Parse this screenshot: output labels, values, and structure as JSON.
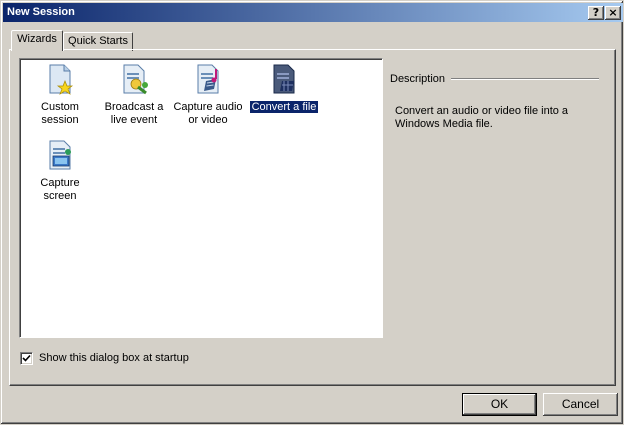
{
  "window": {
    "title": "New Session"
  },
  "titlebar": {
    "help_glyph": "?",
    "close_glyph": "×"
  },
  "tabs": [
    {
      "label": "Wizards",
      "active": true
    },
    {
      "label": "Quick Starts",
      "active": false
    }
  ],
  "wizards": [
    {
      "label_line1": "Custom",
      "label_line2": "session",
      "icon": "custom-session-icon"
    },
    {
      "label_line1": "Broadcast a",
      "label_line2": "live event",
      "icon": "broadcast-icon"
    },
    {
      "label_line1": "Capture audio",
      "label_line2": "or video",
      "icon": "capture-av-icon"
    },
    {
      "label_line1": "Convert a file",
      "label_line2": "",
      "icon": "convert-file-icon",
      "selected": true
    },
    {
      "label_line1": "Capture",
      "label_line2": "screen",
      "icon": "capture-screen-icon"
    }
  ],
  "description": {
    "heading": "Description",
    "text": "Convert an audio or video file into a Windows Media file."
  },
  "startup_checkbox": {
    "label": "Show this dialog box at startup",
    "checked": true
  },
  "buttons": {
    "ok": "OK",
    "cancel": "Cancel"
  },
  "colors": {
    "titlebar_start": "#0a246a",
    "titlebar_end": "#a6caf0",
    "face": "#d4d0c8",
    "selection": "#0a246a"
  }
}
